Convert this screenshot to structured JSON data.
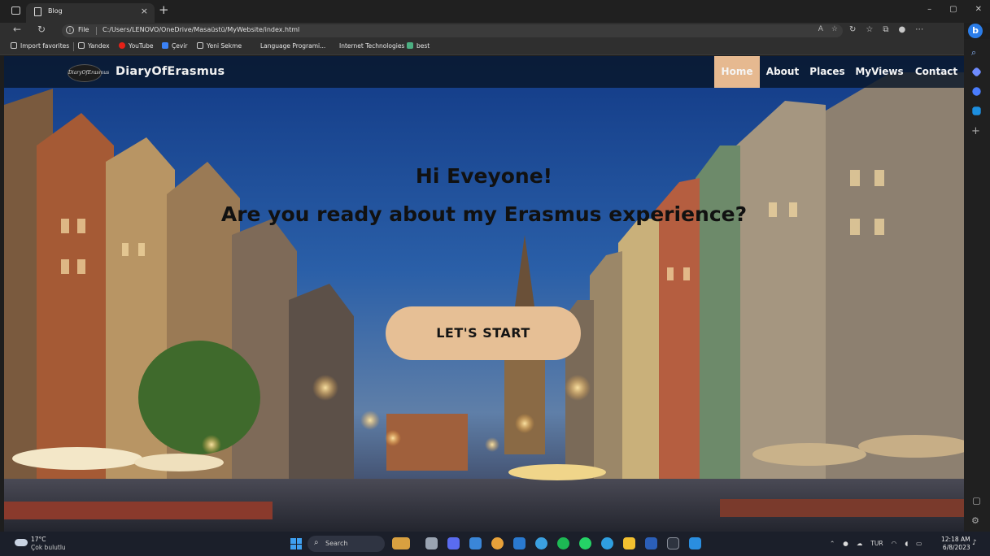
{
  "browser": {
    "tab_title": "Blog",
    "tab_close": "×",
    "new_tab": "+",
    "window_controls": [
      "–",
      "▢",
      "✕"
    ],
    "address": {
      "scheme_label": "File",
      "url": "C:/Users/LENOVO/OneDrive/Masaüstü/MyWebsite/index.html"
    },
    "bookmarks": [
      {
        "label": "Import favorites",
        "icon": "import-icon",
        "color": "#cfcfcf"
      },
      {
        "label": "Yandex",
        "icon": "page-icon",
        "color": "#cfcfcf"
      },
      {
        "label": "YouTube",
        "icon": "youtube-icon",
        "color": "#e62117"
      },
      {
        "label": "Çevir",
        "icon": "translate-icon",
        "color": "#3b82f6"
      },
      {
        "label": "Yeni Sekme",
        "icon": "page-icon",
        "color": "#cfcfcf"
      },
      {
        "label": "Language Programi...",
        "icon": "",
        "color": ""
      },
      {
        "label": "Internet Technologies",
        "icon": "",
        "color": ""
      },
      {
        "label": "best",
        "icon": "folder-icon",
        "color": "#4caf82"
      }
    ]
  },
  "site": {
    "brand": "DiaryOfErasmus",
    "logo_text": "DiaryOfErasmus",
    "nav": [
      {
        "label": "Home",
        "active": true
      },
      {
        "label": "About",
        "active": false
      },
      {
        "label": "Places",
        "active": false
      },
      {
        "label": "MyViews",
        "active": false
      },
      {
        "label": "Contact",
        "active": false
      }
    ],
    "hero": {
      "line1": "Hi Eveyone!",
      "line2": "Are you ready about my Erasmus experience?",
      "cta": "LET'S START"
    },
    "colors": {
      "accent": "#e6bf95",
      "navbar": "#08162a"
    }
  },
  "taskbar": {
    "weather_temp": "17°C",
    "weather_desc": "Çok bulutlu",
    "search_label": "Search",
    "language": "TUR",
    "time": "12:18 AM",
    "date": "6/8/2023"
  }
}
